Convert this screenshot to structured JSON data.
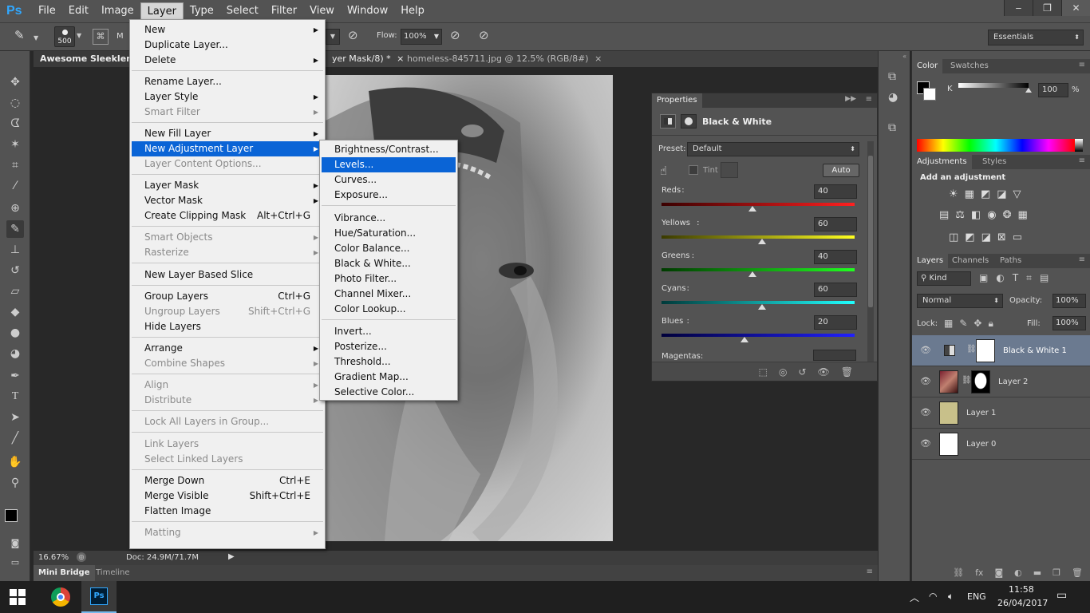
{
  "app": {
    "logo": "Ps"
  },
  "menubar": [
    "File",
    "Edit",
    "Image",
    "Layer",
    "Type",
    "Select",
    "Filter",
    "View",
    "Window",
    "Help"
  ],
  "window_controls": {
    "minimize": "‒",
    "restore": "❐",
    "close": "✕"
  },
  "options_bar": {
    "brush_size": "500",
    "mode_label": "M",
    "flow_label": "Flow:",
    "flow_value": "100%",
    "workspace": "Essentials"
  },
  "doc_tabs": [
    {
      "label": "Awesome Sleeklens L",
      "close": "×"
    },
    {
      "label": "yer Mask/8) *",
      "close": "×"
    },
    {
      "label": "homeless-845711.jpg @ 12.5% (RGB/8#)",
      "close": "×"
    }
  ],
  "status": {
    "zoom": "16.67%",
    "doc": "Doc: 24.9M/71.7M"
  },
  "bottom_tabs": [
    "Mini Bridge",
    "Timeline"
  ],
  "layer_menu": [
    {
      "label": "New",
      "sub": true
    },
    {
      "label": "Duplicate Layer..."
    },
    {
      "label": "Delete",
      "sub": true
    },
    {
      "sep": true
    },
    {
      "label": "Rename Layer..."
    },
    {
      "label": "Layer Style",
      "sub": true
    },
    {
      "label": "Smart Filter",
      "sub": true,
      "disabled": true
    },
    {
      "sep": true
    },
    {
      "label": "New Fill Layer",
      "sub": true
    },
    {
      "label": "New Adjustment Layer",
      "sub": true,
      "highlight": true
    },
    {
      "label": "Layer Content Options...",
      "disabled": true
    },
    {
      "sep": true
    },
    {
      "label": "Layer Mask",
      "sub": true
    },
    {
      "label": "Vector Mask",
      "sub": true
    },
    {
      "label": "Create Clipping Mask",
      "shortcut": "Alt+Ctrl+G"
    },
    {
      "sep": true
    },
    {
      "label": "Smart Objects",
      "sub": true,
      "disabled": true
    },
    {
      "label": "Rasterize",
      "sub": true,
      "disabled": true
    },
    {
      "sep": true
    },
    {
      "label": "New Layer Based Slice"
    },
    {
      "sep": true
    },
    {
      "label": "Group Layers",
      "shortcut": "Ctrl+G"
    },
    {
      "label": "Ungroup Layers",
      "shortcut": "Shift+Ctrl+G",
      "disabled": true
    },
    {
      "label": "Hide Layers"
    },
    {
      "sep": true
    },
    {
      "label": "Arrange",
      "sub": true
    },
    {
      "label": "Combine Shapes",
      "sub": true,
      "disabled": true
    },
    {
      "sep": true
    },
    {
      "label": "Align",
      "sub": true,
      "disabled": true
    },
    {
      "label": "Distribute",
      "sub": true,
      "disabled": true
    },
    {
      "sep": true
    },
    {
      "label": "Lock All Layers in Group...",
      "disabled": true
    },
    {
      "sep": true
    },
    {
      "label": "Link Layers",
      "disabled": true
    },
    {
      "label": "Select Linked Layers",
      "disabled": true
    },
    {
      "sep": true
    },
    {
      "label": "Merge Down",
      "shortcut": "Ctrl+E"
    },
    {
      "label": "Merge Visible",
      "shortcut": "Shift+Ctrl+E"
    },
    {
      "label": "Flatten Image"
    },
    {
      "sep": true
    },
    {
      "label": "Matting",
      "sub": true,
      "disabled": true
    }
  ],
  "adjustment_menu": [
    {
      "label": "Brightness/Contrast..."
    },
    {
      "label": "Levels...",
      "highlight": true
    },
    {
      "label": "Curves..."
    },
    {
      "label": "Exposure..."
    },
    {
      "sep": true
    },
    {
      "label": "Vibrance..."
    },
    {
      "label": "Hue/Saturation..."
    },
    {
      "label": "Color Balance..."
    },
    {
      "label": "Black & White..."
    },
    {
      "label": "Photo Filter..."
    },
    {
      "label": "Channel Mixer..."
    },
    {
      "label": "Color Lookup..."
    },
    {
      "sep": true
    },
    {
      "label": "Invert..."
    },
    {
      "label": "Posterize..."
    },
    {
      "label": "Threshold..."
    },
    {
      "label": "Gradient Map..."
    },
    {
      "label": "Selective Color..."
    }
  ],
  "properties": {
    "tab": "Properties",
    "title": "Black & White",
    "preset_label": "Preset:",
    "preset_value": "Default",
    "tint_label": "Tint",
    "auto_label": "Auto",
    "sliders": [
      {
        "label": "Reds",
        "value": "40",
        "pos": 0.47,
        "gradient": "linear-gradient(90deg,#3a0000,#ff2020)"
      },
      {
        "label": "Yellows",
        "value": "60",
        "pos": 0.52,
        "gradient": "linear-gradient(90deg,#3a3a00,#ffff20)"
      },
      {
        "label": "Greens",
        "value": "40",
        "pos": 0.47,
        "gradient": "linear-gradient(90deg,#003a00,#20ff20)"
      },
      {
        "label": "Cyans",
        "value": "60",
        "pos": 0.52,
        "gradient": "linear-gradient(90deg,#003a3a,#20ffff)"
      },
      {
        "label": "Blues",
        "value": "20",
        "pos": 0.43,
        "gradient": "linear-gradient(90deg,#00003a,#2020ff)"
      }
    ],
    "magentas_label": "Magentas:"
  },
  "color_panel": {
    "tabs": [
      "Color",
      "Swatches"
    ],
    "channel": "K",
    "value": "100",
    "unit": "%"
  },
  "adjustments_panel": {
    "tabs": [
      "Adjustments",
      "Styles"
    ],
    "heading": "Add an adjustment"
  },
  "layers_panel": {
    "tabs": [
      "Layers",
      "Channels",
      "Paths"
    ],
    "kind": "Kind",
    "blend_mode": "Normal",
    "opacity_label": "Opacity:",
    "opacity_value": "100%",
    "lock_label": "Lock:",
    "fill_label": "Fill:",
    "fill_value": "100%",
    "layers": [
      {
        "name": "Black & White 1",
        "selected": true
      },
      {
        "name": "Layer 2"
      },
      {
        "name": "Layer 1"
      },
      {
        "name": "Layer 0"
      }
    ]
  },
  "taskbar": {
    "lang": "ENG",
    "time": "11:58",
    "date": "26/04/2017",
    "ps_icon": "Ps"
  }
}
